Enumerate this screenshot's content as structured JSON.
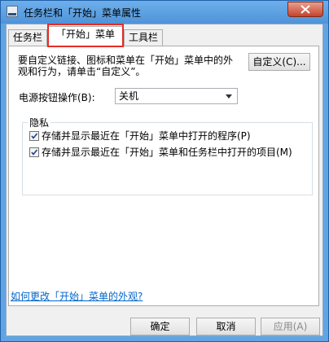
{
  "window": {
    "title": "任务栏和「开始」菜单属性"
  },
  "tabs": [
    {
      "label": "任务栏",
      "active": false
    },
    {
      "label": "「开始」菜单",
      "active": true
    },
    {
      "label": "工具栏",
      "active": false
    }
  ],
  "start_menu": {
    "description": "要自定义链接、图标和菜单在「开始」菜单中的外观和行为，请单击“自定义”。",
    "customize_button": "自定义(C)...",
    "power_label": "电源按钮操作(B):",
    "power_value": "关机",
    "privacy": {
      "title": "隐私",
      "options": [
        {
          "label": "存储并显示最近在「开始」菜单中打开的程序(P)",
          "checked": true
        },
        {
          "label": "存储并显示最近在「开始」菜单和任务栏中打开的项目(M)",
          "checked": true
        }
      ]
    },
    "help_link": "如何更改「开始」菜单的外观?"
  },
  "footer": {
    "ok": "确定",
    "cancel": "取消",
    "apply": "应用(A)"
  },
  "icons": {
    "close": "close-icon",
    "window": "window-app-icon",
    "dropdown": "chevron-down-icon",
    "check": "checkmark-icon"
  },
  "colors": {
    "title_bar": "#62a4e2",
    "close_button": "#c7432c",
    "highlight_box": "#e52c24",
    "link": "#0066cc"
  }
}
